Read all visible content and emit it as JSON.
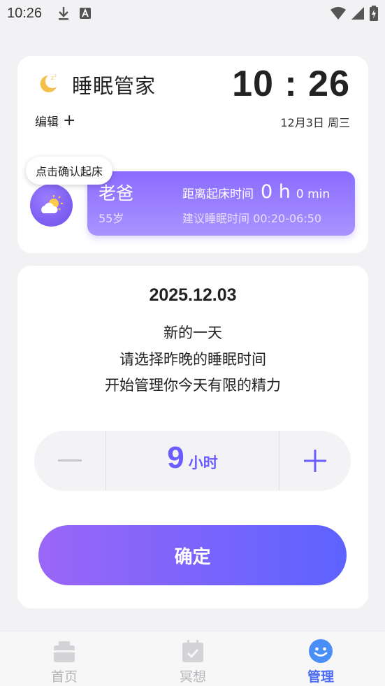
{
  "status_bar": {
    "time": "10:26"
  },
  "header": {
    "app_title": "睡眠管家",
    "clock": "10 : 26",
    "edit_label": "编辑",
    "edit_plus": "+",
    "date": "12月3日 周三"
  },
  "member": {
    "tooltip": "点击确认起床",
    "name": "老爸",
    "age": "55岁",
    "countdown_label": "距离起床时间",
    "countdown_hours": "0 h",
    "countdown_minutes": "0 min",
    "suggest": "建议睡眠时间 00:20-06:50"
  },
  "sleep_select": {
    "date": "2025.12.03",
    "line1": "新的一天",
    "line2": "请选择昨晚的睡眠时间",
    "line3": "开始管理你今天有限的精力",
    "hours": "9",
    "unit": "小时",
    "confirm_label": "确定"
  },
  "tabbar": {
    "tabs": [
      {
        "label": "首页",
        "icon": "home-icon",
        "active": false
      },
      {
        "label": "冥想",
        "icon": "calendar-check-icon",
        "active": false
      },
      {
        "label": "管理",
        "icon": "smile-icon",
        "active": true
      }
    ]
  },
  "colors": {
    "accent": "#6a5cff",
    "tab_active": "#4a6cf7",
    "member_card": "#8a6cff"
  }
}
